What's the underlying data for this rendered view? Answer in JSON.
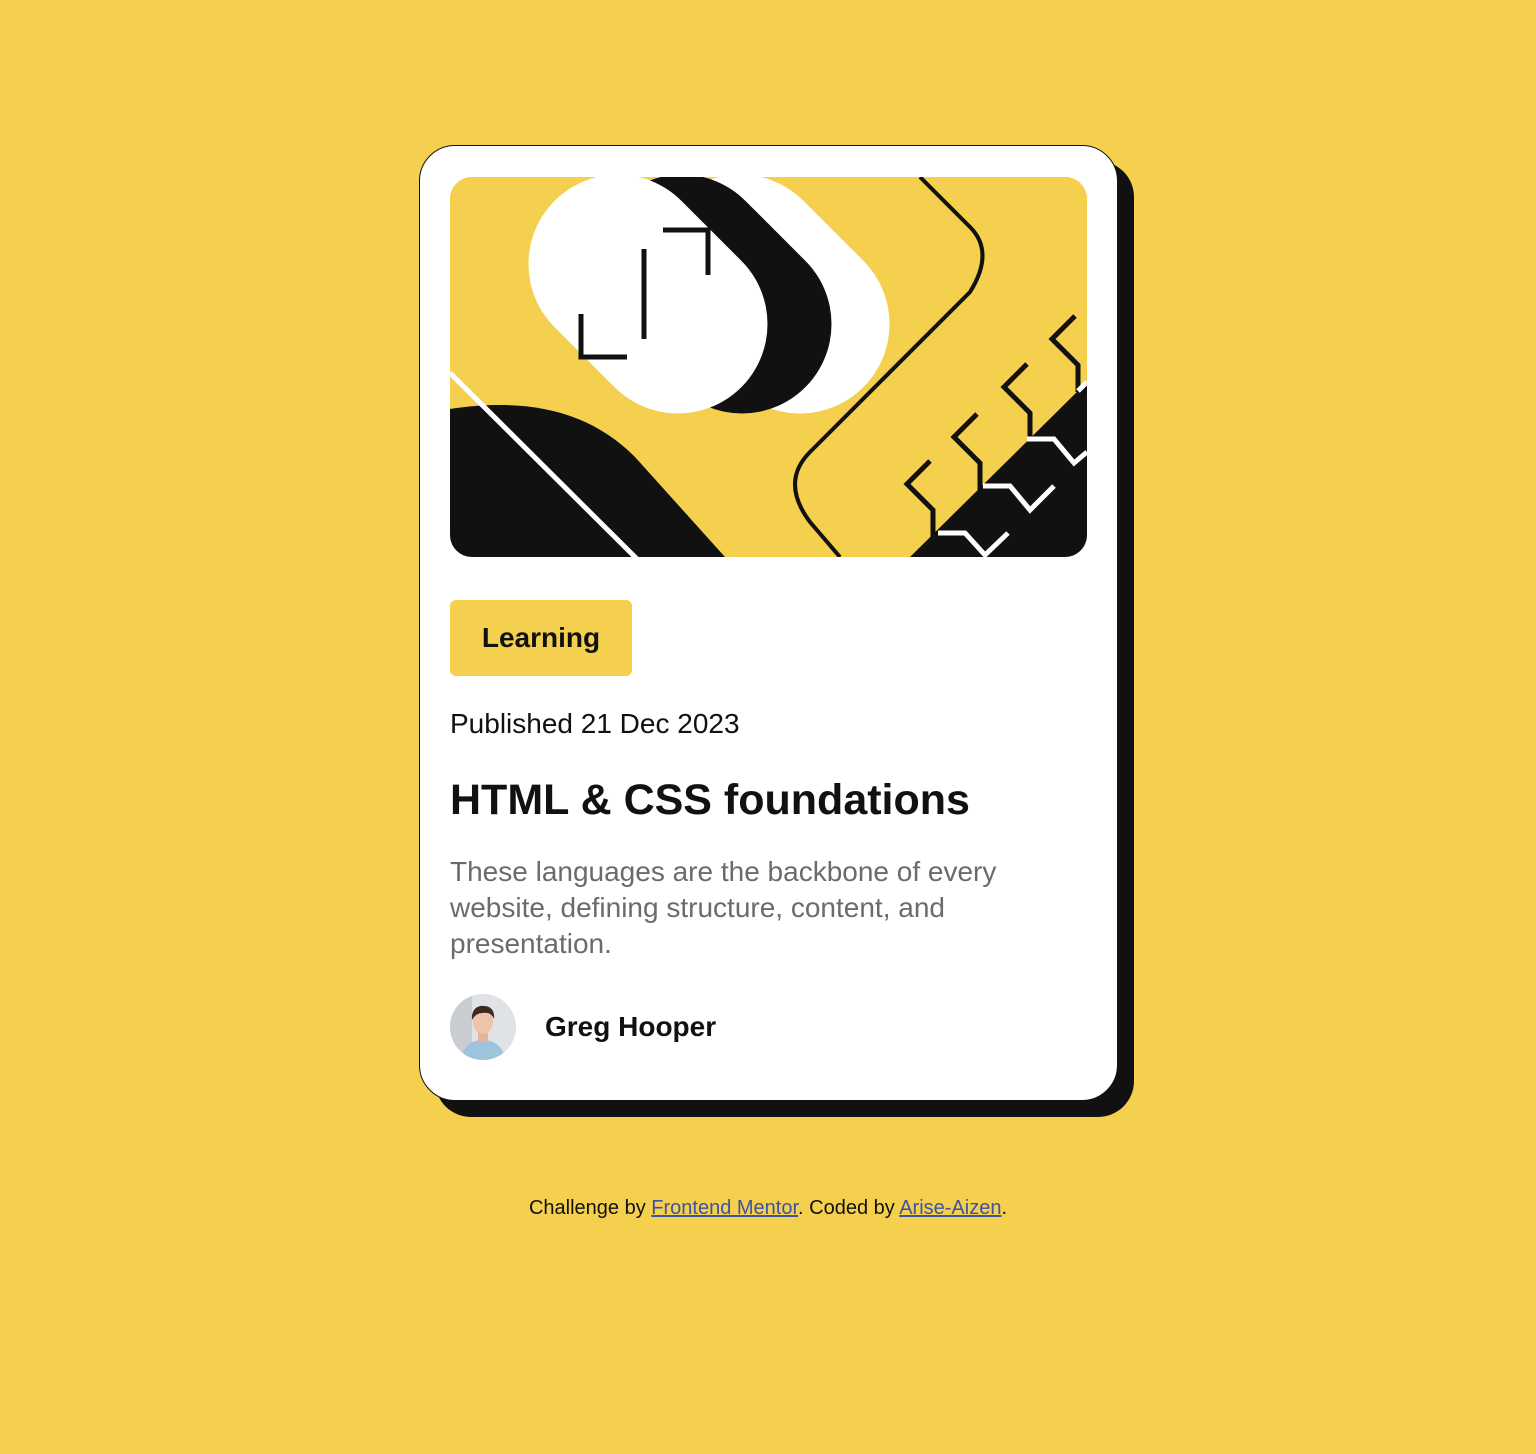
{
  "card": {
    "tag": "Learning",
    "published": "Published 21 Dec 2023",
    "title": "HTML & CSS foundations",
    "description": "These languages are the backbone of every website, defining structure, content, and presentation.",
    "author": {
      "name": "Greg Hooper"
    }
  },
  "attribution": {
    "prefix": "Challenge by ",
    "link1": "Frontend Mentor",
    "middle": ". Coded by ",
    "link2": "Arise-Aizen",
    "suffix": "."
  },
  "colors": {
    "background": "#f4d04e",
    "card": "#ffffff",
    "ink": "#111111",
    "muted_text": "#6b6b6b",
    "link": "#3e52a3"
  },
  "icons": {
    "hero": "abstract-code-illustration",
    "avatar": "author-avatar"
  }
}
